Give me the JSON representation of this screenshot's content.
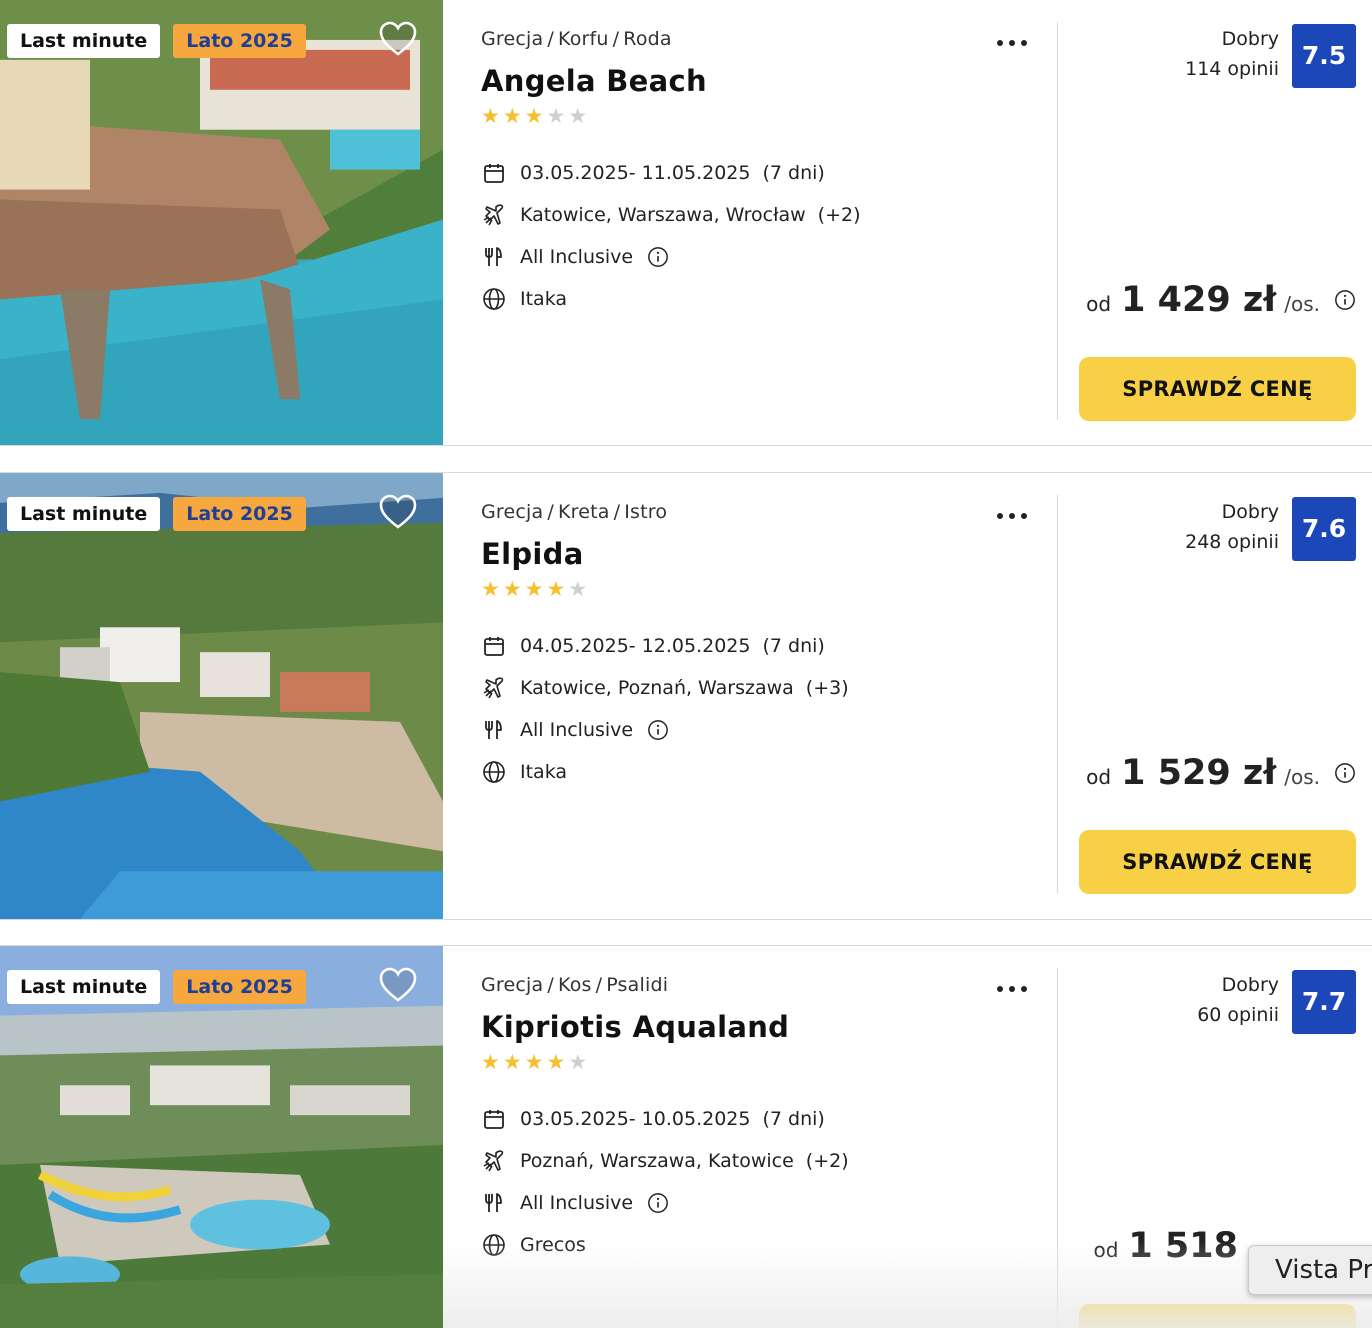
{
  "offers": [
    {
      "badges": [
        "Last minute",
        "Lato 2025"
      ],
      "breadcrumb": [
        "Grecja",
        "Korfu",
        "Roda"
      ],
      "name": "Angela Beach",
      "stars": 3,
      "dates": "03.05.2025- 11.05.2025",
      "duration": "(7 dni)",
      "airports": "Katowice, Warszawa, Wrocław",
      "airports_more": "(+2)",
      "board": "All Inclusive",
      "operator": "Itaka",
      "rating_label": "Dobry",
      "reviews": "114 opinii",
      "score": "7.5",
      "price_prefix": "od",
      "price": "1 429 zł",
      "price_suffix": "/os.",
      "cta": "SPRAWDŹ CENĘ"
    },
    {
      "badges": [
        "Last minute",
        "Lato 2025"
      ],
      "breadcrumb": [
        "Grecja",
        "Kreta",
        "Istro"
      ],
      "name": "Elpida",
      "stars": 4,
      "dates": "04.05.2025- 12.05.2025",
      "duration": "(7 dni)",
      "airports": "Katowice, Poznań, Warszawa",
      "airports_more": "(+3)",
      "board": "All Inclusive",
      "operator": "Itaka",
      "rating_label": "Dobry",
      "reviews": "248 opinii",
      "score": "7.6",
      "price_prefix": "od",
      "price": "1 529 zł",
      "price_suffix": "/os.",
      "cta": "SPRAWDŹ CENĘ"
    },
    {
      "badges": [
        "Last minute",
        "Lato 2025"
      ],
      "breadcrumb": [
        "Grecja",
        "Kos",
        "Psalidi"
      ],
      "name": "Kipriotis Aqualand",
      "stars": 4,
      "dates": "03.05.2025- 10.05.2025",
      "duration": "(7 dni)",
      "airports": "Poznań, Warszawa, Katowice",
      "airports_more": "(+2)",
      "board": "All Inclusive",
      "operator": "Grecos",
      "rating_label": "Dobry",
      "reviews": "60 opinii",
      "score": "7.7",
      "price_prefix": "od",
      "price": "1 518",
      "price_suffix": "",
      "cta": ""
    }
  ],
  "tooltip": "Vista Pr",
  "icons": {
    "favorite": "heart-icon",
    "more": "more-dots-icon",
    "date": "calendar-icon",
    "flight": "plane-icon",
    "board": "cutlery-icon",
    "operator": "globe-icon",
    "info": "info-icon"
  },
  "colors": {
    "score_bg": "#1c47b8",
    "cta_bg": "#f7d046",
    "badge_orange": "#f6a73d",
    "star_on": "#f5c02d"
  }
}
